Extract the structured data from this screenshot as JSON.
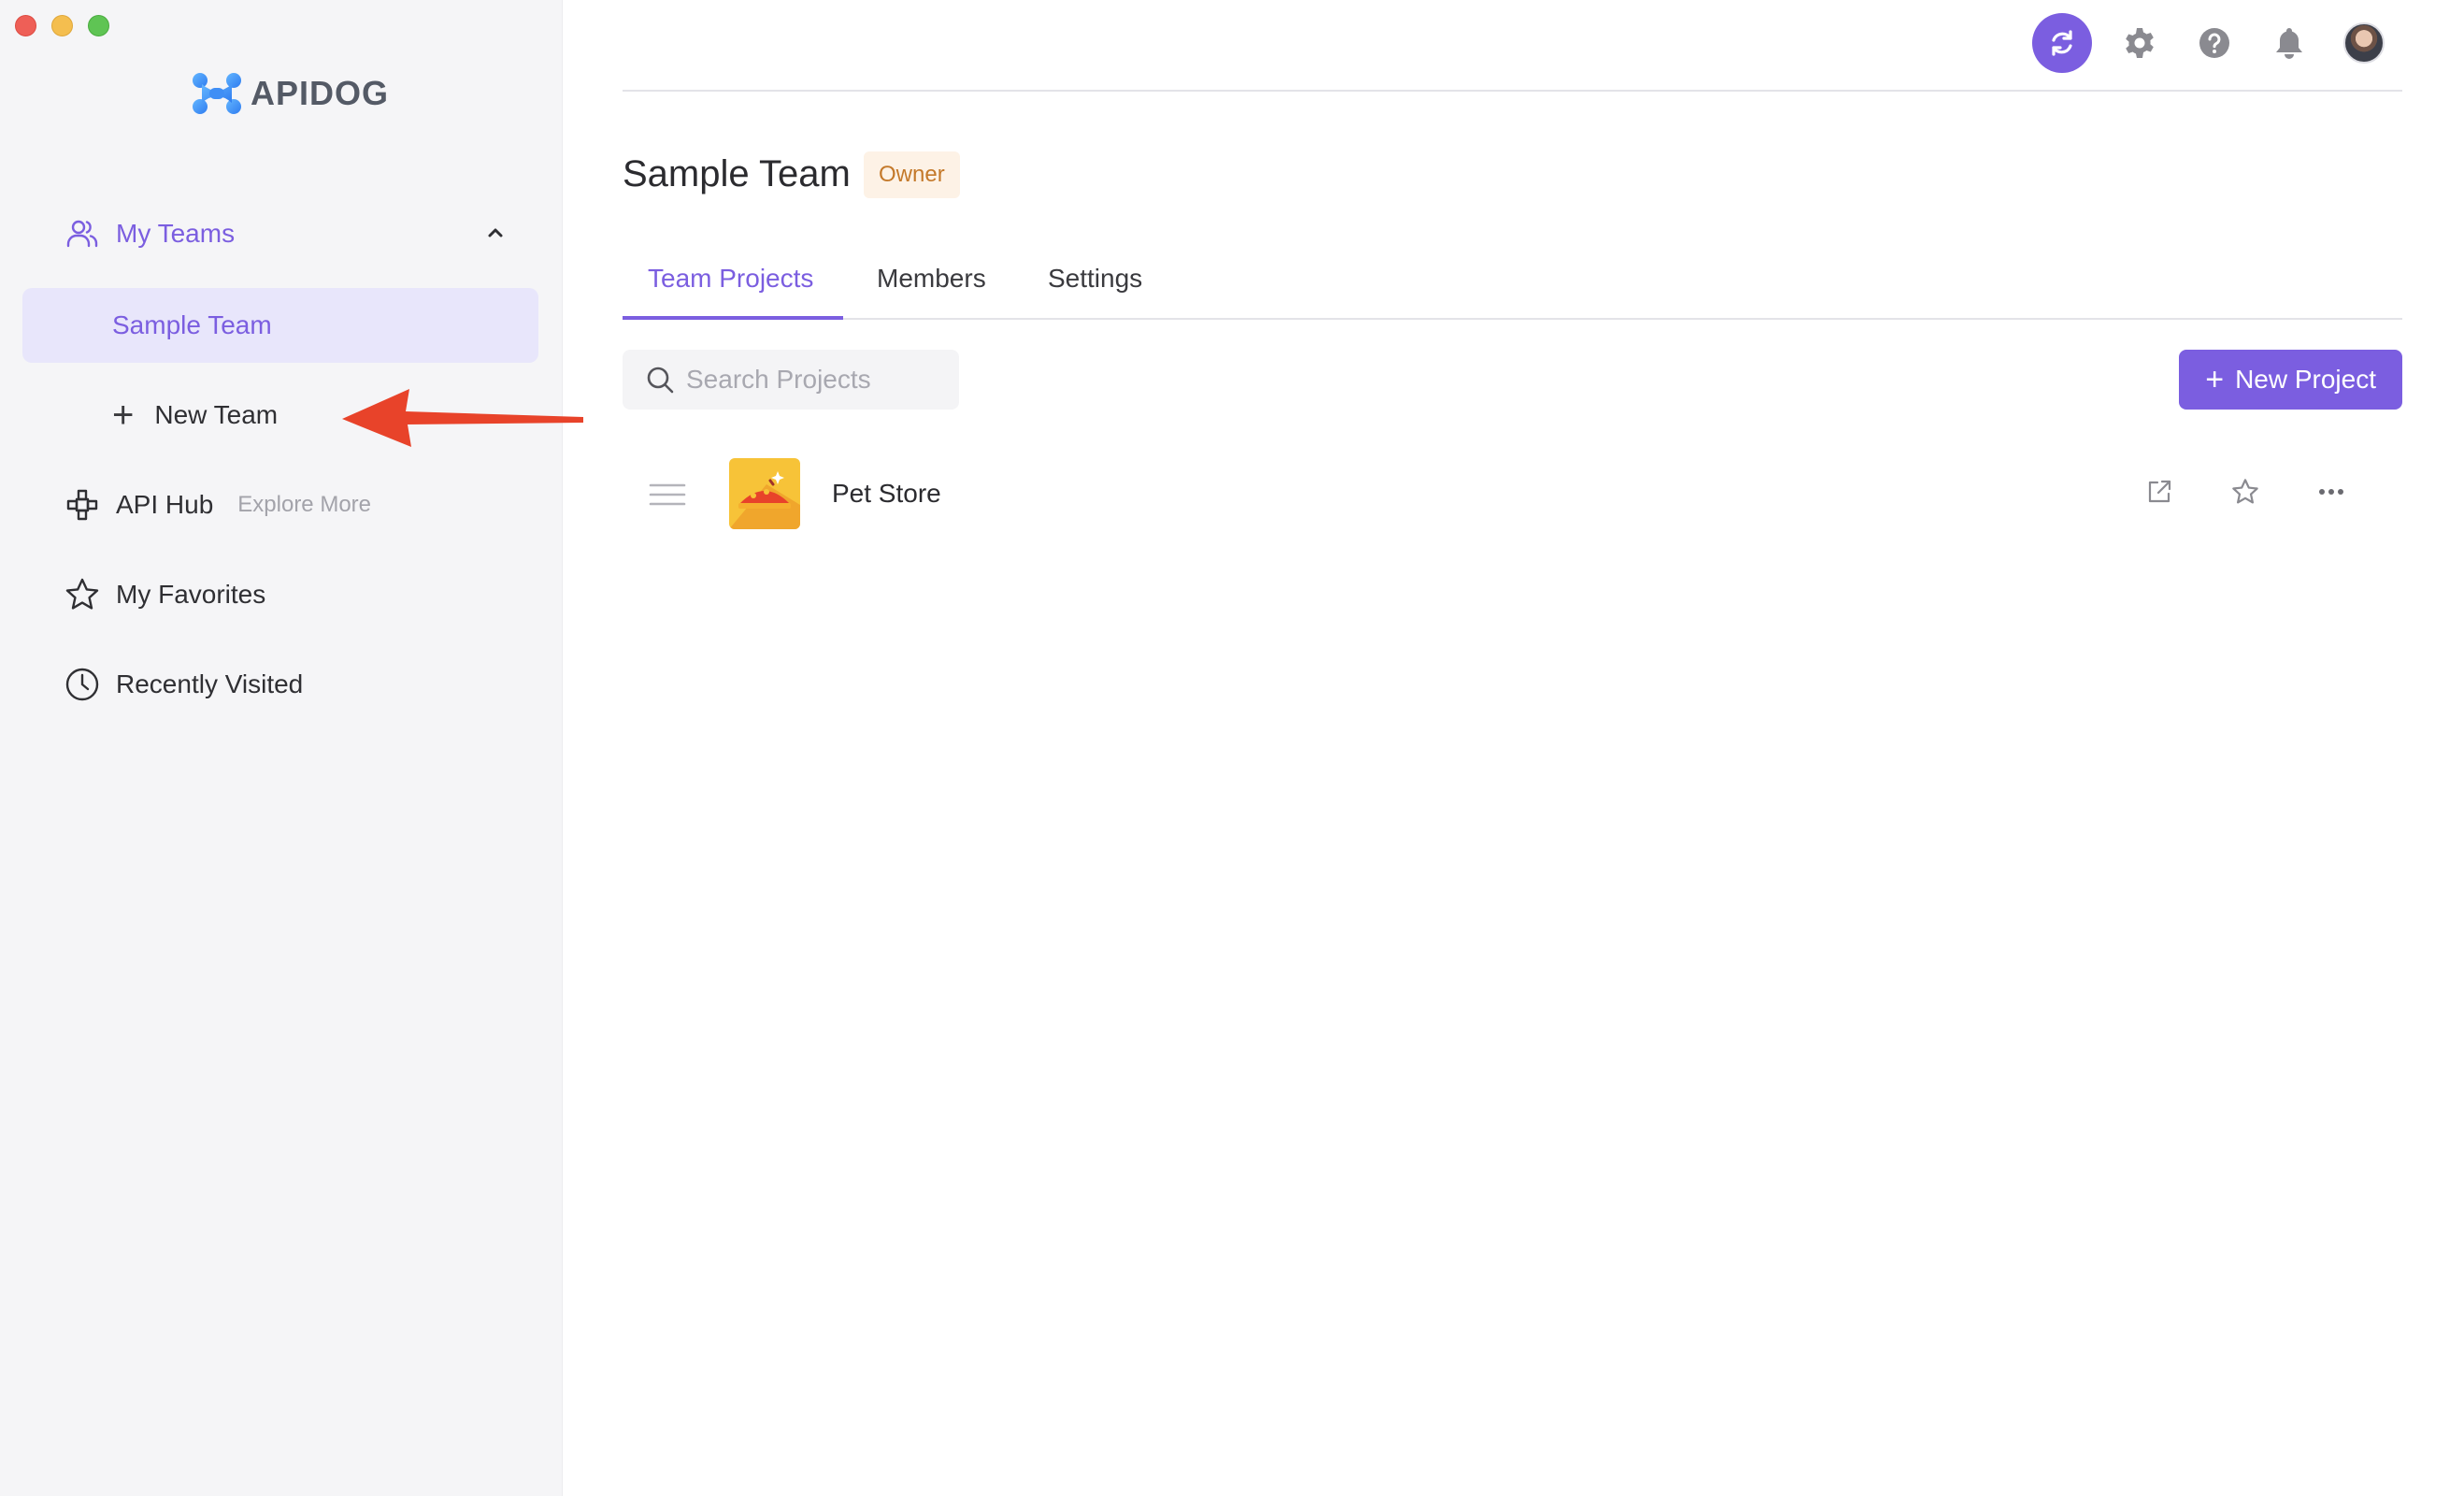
{
  "app": {
    "logo_text": "APIDOG"
  },
  "sidebar": {
    "my_teams": "My Teams",
    "selected_team": "Sample Team",
    "new_team": "New Team",
    "api_hub": "API Hub",
    "explore_more": "Explore More",
    "my_favorites": "My Favorites",
    "recently_visited": "Recently Visited"
  },
  "header": {
    "team_name": "Sample Team",
    "role_badge": "Owner"
  },
  "tabs": [
    {
      "label": "Team Projects"
    },
    {
      "label": "Members"
    },
    {
      "label": "Settings"
    }
  ],
  "toolbar": {
    "search_placeholder": "Search Projects",
    "new_project": "New Project"
  },
  "projects": [
    {
      "name": "Pet Store"
    }
  ],
  "colors": {
    "accent": "#7b5ee0",
    "selected_bg": "#e8e6fb",
    "badge_bg": "#fdf2e6",
    "badge_text": "#c4792a",
    "annotation_arrow": "#e8432a"
  }
}
